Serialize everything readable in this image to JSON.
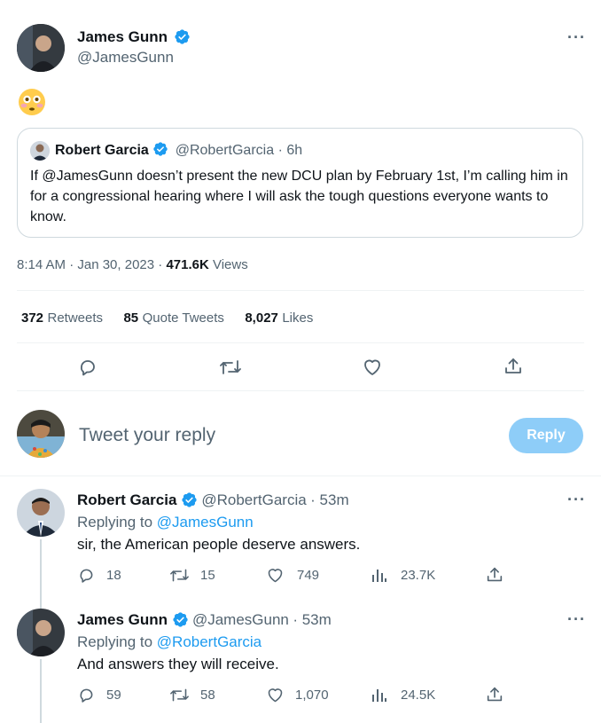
{
  "main_tweet": {
    "author_name": "James Gunn",
    "author_handle": "@JamesGunn",
    "body_emoji": "😳",
    "quoted": {
      "author_name": "Robert Garcia",
      "author_handle": "@RobertGarcia",
      "time": "· 6h",
      "text": "If @JamesGunn doesn’t present the new DCU plan by February 1st, I’m calling him in for a congressional hearing where I will ask the tough questions everyone wants to know."
    },
    "timestamp": "8:14 AM · Jan 30, 2023 · ",
    "views_count": "471.6K",
    "views_label": " Views",
    "stats": {
      "retweets_count": "372",
      "retweets_label": "Retweets",
      "quotes_count": "85",
      "quotes_label": "Quote Tweets",
      "likes_count": "8,027",
      "likes_label": "Likes"
    }
  },
  "composer": {
    "placeholder": "Tweet your reply",
    "reply_button": "Reply"
  },
  "replies": [
    {
      "author_name": "Robert Garcia",
      "author_handle": "@RobertGarcia",
      "time": "· 53m",
      "replying_prefix": "Replying to ",
      "replying_to": "@JamesGunn",
      "text": "sir, the American people deserve answers.",
      "replies": "18",
      "retweets": "15",
      "likes": "749",
      "views": "23.7K"
    },
    {
      "author_name": "James Gunn",
      "author_handle": "@JamesGunn",
      "time": "· 53m",
      "replying_prefix": "Replying to ",
      "replying_to": "@RobertGarcia",
      "text": "And answers they will receive.",
      "replies": "59",
      "retweets": "58",
      "likes": "1,070",
      "views": "24.5K"
    }
  ],
  "colors": {
    "accent": "#1d9bf0",
    "reply_button_disabled": "#8ecdf8",
    "text_secondary": "#536471"
  }
}
